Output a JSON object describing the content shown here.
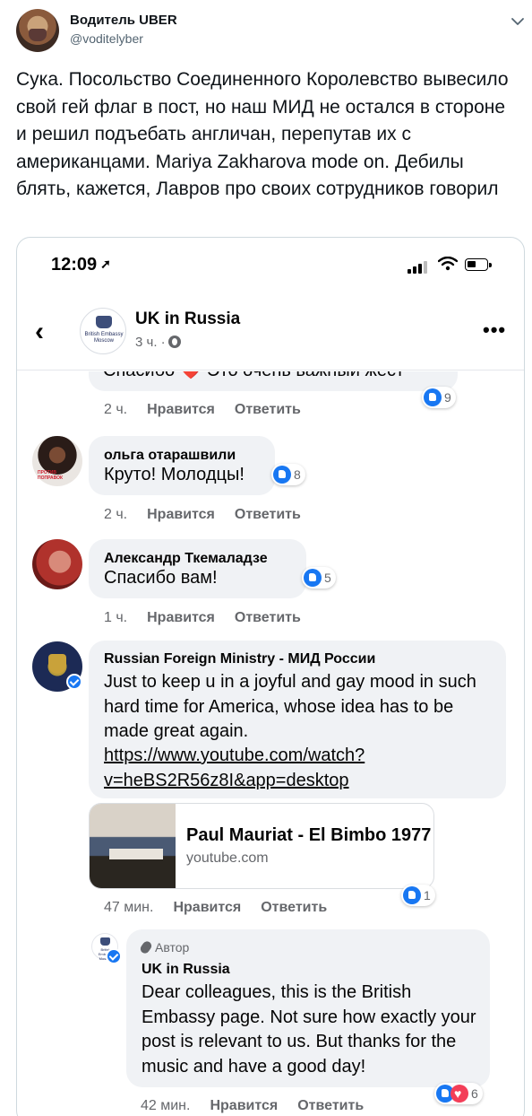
{
  "tweet": {
    "author_name": "Водитель UBER",
    "author_handle": "@voditelyber",
    "text": "Сука. Посольство Соединенного Королевство вывесило свой гей флаг в пост, но наш МИД не остался в стороне и решил подъебать англичан, перепутав их с американцами. Mariya Zakharova mode on. Дебилы блять, кажется, Лавров про своих сотрудников говорил"
  },
  "status_bar": {
    "time": "12:09",
    "location_glyph": "➚"
  },
  "fb_header": {
    "back_glyph": "‹",
    "page_name": "UK in Russia",
    "meta": "3 ч. ·",
    "more_glyph": "•••",
    "avatar_text": "British Embassy Moscow"
  },
  "comments": [
    {
      "partial_text": "Спасибо ❤️ Это очень важный жест",
      "time": "2 ч.",
      "like_label": "Нравится",
      "reply_label": "Ответить",
      "reactions": {
        "count": "9",
        "types": [
          "like"
        ]
      }
    },
    {
      "author": "ольга отарашвили",
      "text": "Круто! Молодцы!",
      "avatar_label": "ПРОТИВ ПОПРАВОК",
      "time": "2 ч.",
      "like_label": "Нравится",
      "reply_label": "Ответить",
      "reactions": {
        "count": "8",
        "types": [
          "like"
        ]
      }
    },
    {
      "author": "Александр Ткемаладзе",
      "text": "Спасибо вам!",
      "time": "1 ч.",
      "like_label": "Нравится",
      "reply_label": "Ответить",
      "reactions": {
        "count": "5",
        "types": [
          "like"
        ]
      }
    },
    {
      "author": "Russian Foreign Ministry - МИД России",
      "text": "Just to keep u in a joyful and gay mood in such hard time for America, whose idea has to be made great again.",
      "link": "https://www.youtube.com/watch?v=heBS2R56z8I&app=desktop",
      "link_line1": "https://www.youtube.com/watch?",
      "link_line2": "v=heBS2R56z8I&app=desktop",
      "preview_title": "Paul Mauriat - El Bimbo 1977",
      "preview_domain": "youtube.com",
      "verified": true,
      "time": "47 мин.",
      "like_label": "Нравится",
      "reply_label": "Ответить",
      "reactions": {
        "count": "1",
        "types": [
          "like"
        ]
      }
    },
    {
      "badge": "Автор",
      "author": "UK in Russia",
      "text": "Dear colleagues, this is the British Embassy page. Not sure how exactly your post is relevant to us. But thanks for the music and have a good day!",
      "avatar_text": "British Embassy Moscow",
      "verified": true,
      "time": "42 мин.",
      "like_label": "Нравится",
      "reply_label": "Ответить",
      "reactions": {
        "count": "6",
        "types": [
          "like",
          "love"
        ]
      }
    }
  ],
  "colors": {
    "fb_blue": "#1877f2",
    "love_red": "#f33e58",
    "bubble_bg": "#f0f2f5",
    "muted": "#65676b"
  }
}
